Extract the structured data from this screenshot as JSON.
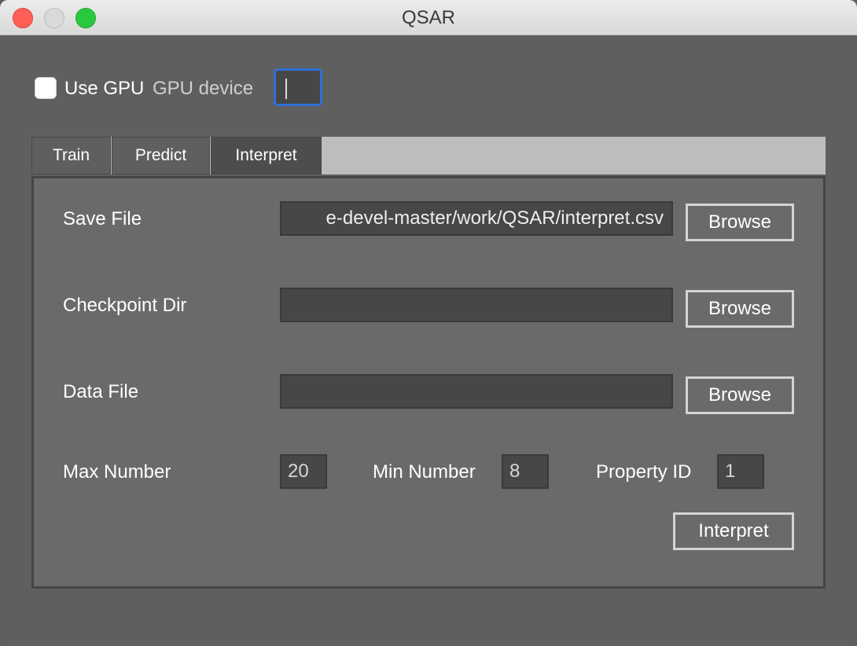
{
  "window": {
    "title": "QSAR"
  },
  "gpu": {
    "use_gpu_label": "Use GPU",
    "use_gpu_checked": false,
    "device_label": "GPU device",
    "device_value": ""
  },
  "tabs": [
    {
      "label": "Train",
      "active": false
    },
    {
      "label": "Predict",
      "active": false
    },
    {
      "label": "Interpret",
      "active": true
    }
  ],
  "interpret": {
    "save_file": {
      "label": "Save File",
      "value": "e-devel-master/work/QSAR/interpret.csv",
      "button": "Browse"
    },
    "checkpoint_dir": {
      "label": "Checkpoint Dir",
      "value": "",
      "button": "Browse"
    },
    "data_file": {
      "label": "Data File",
      "value": "",
      "button": "Browse"
    },
    "max_number": {
      "label": "Max Number",
      "value": "20"
    },
    "min_number": {
      "label": "Min Number",
      "value": "8"
    },
    "property_id": {
      "label": "Property ID",
      "value": "1"
    },
    "run_button": "Interpret"
  },
  "colors": {
    "background": "#5f5f5f",
    "panel": "#6a6a6a",
    "input": "#474747",
    "focus": "#2f6fd6",
    "close": "#fe5f57",
    "maximize": "#2ac840"
  }
}
